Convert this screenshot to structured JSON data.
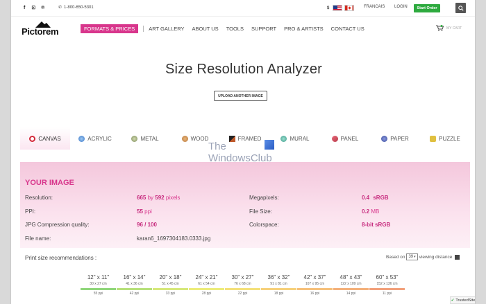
{
  "topbar": {
    "social": [
      "f",
      "⊡",
      "℗"
    ],
    "phone": "1-800-650-5301",
    "currency": "$",
    "language": "FRANCAIS",
    "login": "LOGIN",
    "start_order": "Start Order"
  },
  "brand": {
    "logo": "Pictorem"
  },
  "nav": [
    {
      "label": "FORMATS & PRICES",
      "active": true
    },
    {
      "label": "ART GALLERY",
      "active": false
    },
    {
      "label": "ABOUT US",
      "active": false
    },
    {
      "label": "TOOLS",
      "active": false
    },
    {
      "label": "SUPPORT",
      "active": false
    },
    {
      "label": "PRO & ARTISTS",
      "active": false
    },
    {
      "label": "CONTACT US",
      "active": false
    }
  ],
  "cart": {
    "label": "MY CART"
  },
  "header": {
    "title": "Size Resolution Analyzer",
    "upload_button": "UPLOAD ANOTHER IMAGE"
  },
  "tabs": [
    {
      "label": "CANVAS",
      "icon": "canvas-icon",
      "color": "#d42a3a",
      "active": true
    },
    {
      "label": "ACRYLIC",
      "icon": "acrylic-icon",
      "color": "#3a76c8",
      "active": false
    },
    {
      "label": "METAL",
      "icon": "metal-icon",
      "color": "#7a8a5a",
      "active": false
    },
    {
      "label": "WOOD",
      "icon": "wood-icon",
      "color": "#b8763a",
      "active": false
    },
    {
      "label": "FRAMED",
      "icon": "framed-icon",
      "color": "#c0592a",
      "active": false
    },
    {
      "label": "MURAL",
      "icon": "mural-icon",
      "color": "#3a9a8a",
      "active": false
    },
    {
      "label": "PANEL",
      "icon": "panel-icon",
      "color": "#b83a4a",
      "active": false
    },
    {
      "label": "PAPER",
      "icon": "paper-icon",
      "color": "#3a4a9a",
      "active": false
    },
    {
      "label": "PUZZLE",
      "icon": "puzzle-icon",
      "color": "#e0c040",
      "active": false
    }
  ],
  "watermark": {
    "line1": "The",
    "line2": "WindowsClub"
  },
  "image_info": {
    "heading": "YOUR IMAGE",
    "resolution_label": "Resolution:",
    "res_width": "665",
    "res_by": "by",
    "res_height": "592",
    "res_unit": "pixels",
    "ppi_label": "PPI:",
    "ppi_value": "55",
    "ppi_unit": "ppi",
    "jpg_label": "JPG Compression quality:",
    "jpg_value": "96 / 100",
    "file_label": "File name:",
    "file_value": "karan6_1697304183.0333.jpg",
    "mp_label": "Megapixels:",
    "mp_value": "0.4",
    "mp_space": "sRGB",
    "fs_label": "File Size:",
    "fs_value": "0.2",
    "fs_unit": "MB",
    "cs_label": "Colorspace:",
    "cs_value": "8-bit sRGB"
  },
  "recommendations": {
    "label": "Print size recommendations :",
    "distance_prefix": "Based on",
    "distance_value": "39",
    "distance_suffix": "viewing distance",
    "sizes": [
      {
        "inches": "12\" x 11\"",
        "cm": "30 x 27 cm",
        "ppi": "55 ppi",
        "color": "#8fd67a"
      },
      {
        "inches": "16\" x 14\"",
        "cm": "41 x 36 cm",
        "ppi": "42 ppi",
        "color": "#b6e07a"
      },
      {
        "inches": "20\" x 18\"",
        "cm": "51 x 45 cm",
        "ppi": "33 ppi",
        "color": "#d6e87a"
      },
      {
        "inches": "24\" x 21\"",
        "cm": "61 x 54 cm",
        "ppi": "28 ppi",
        "color": "#ecec7a"
      },
      {
        "inches": "30\" x 27\"",
        "cm": "76 x 68 cm",
        "ppi": "22 ppi",
        "color": "#f4e07a"
      },
      {
        "inches": "36\" x 32\"",
        "cm": "91 x 81 cm",
        "ppi": "18 ppi",
        "color": "#f6d07a"
      },
      {
        "inches": "42\" x 37\"",
        "cm": "107 x 95 cm",
        "ppi": "16 ppi",
        "color": "#f6c07a"
      },
      {
        "inches": "48\" x 43\"",
        "cm": "122 x 109 cm",
        "ppi": "14 ppi",
        "color": "#f4b07a"
      },
      {
        "inches": "60\" x 53\"",
        "cm": "152 x 136 cm",
        "ppi": "11 ppi",
        "color": "#f2a07a"
      }
    ]
  },
  "trusted": {
    "label": "TrustedSite"
  }
}
